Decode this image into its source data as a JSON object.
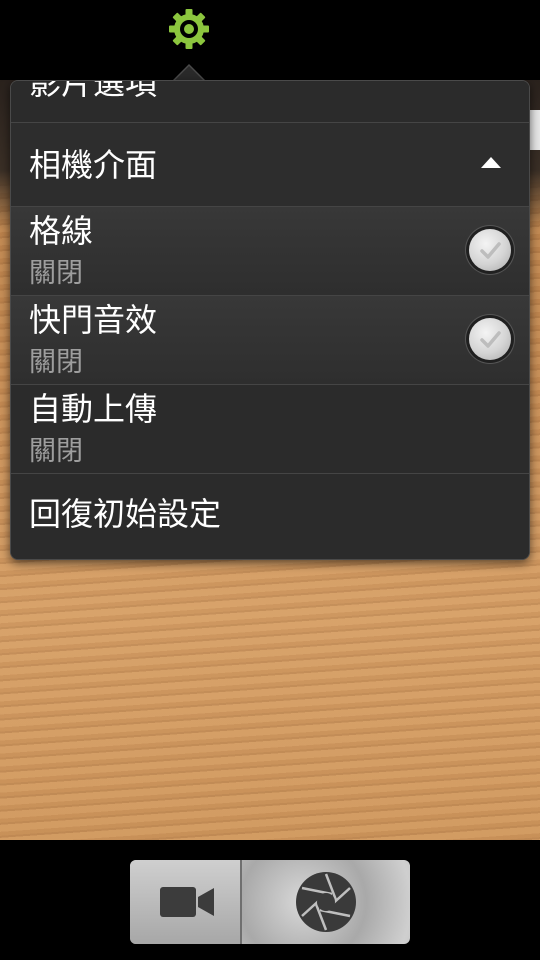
{
  "menu": {
    "clipped_item_label": "影片選項",
    "section_header": "相機介面",
    "items": [
      {
        "title": "格線",
        "value": "關閉",
        "has_toggle": true
      },
      {
        "title": "快門音效",
        "value": "關閉",
        "has_toggle": true
      },
      {
        "title": "自動上傳",
        "value": "關閉",
        "has_toggle": false
      }
    ],
    "reset_label": "回復初始設定"
  },
  "icons": {
    "settings": "gear-icon",
    "collapse": "chevron-up-icon",
    "video_mode": "video-camera-icon",
    "shutter": "aperture-icon",
    "toggle": "checkmark-icon"
  },
  "colors": {
    "gear": "#8cc63e",
    "menu_background": "#2a2a2a",
    "text_primary": "#ffffff",
    "text_secondary": "#9e9e9e"
  }
}
